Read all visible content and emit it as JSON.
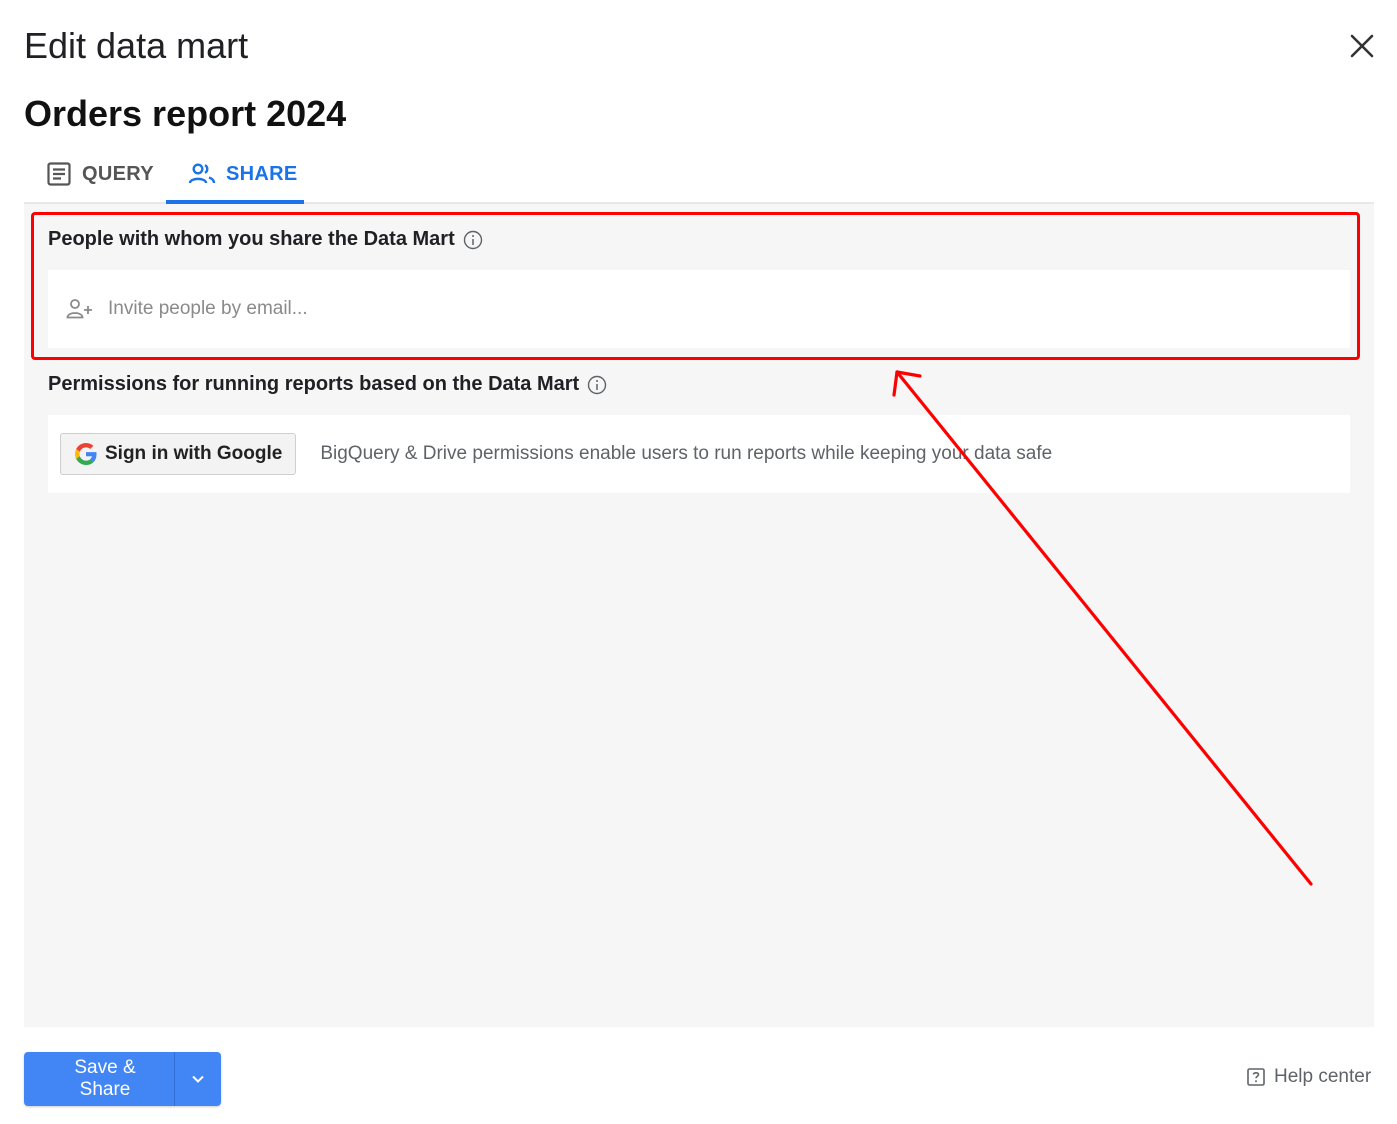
{
  "dialog": {
    "title": "Edit data mart",
    "mart_name": "Orders report 2024"
  },
  "tabs": [
    {
      "label": "QUERY",
      "icon": "document-list-icon",
      "active": false
    },
    {
      "label": "SHARE",
      "icon": "people-icon",
      "active": true
    }
  ],
  "share_section": {
    "label": "People with whom you share the Data Mart",
    "invite_placeholder": "Invite people by email...",
    "invite_value": ""
  },
  "permissions_section": {
    "label": "Permissions for running reports based on the Data Mart",
    "sign_in_label": "Sign in with Google",
    "description": "BigQuery & Drive permissions enable users to run reports while keeping your data safe"
  },
  "footer": {
    "save_label": "Save & Share",
    "help_label": "Help center"
  },
  "colors": {
    "accent": "#1a73e8",
    "primary_button": "#4285f4",
    "annotation": "#ff0000"
  }
}
